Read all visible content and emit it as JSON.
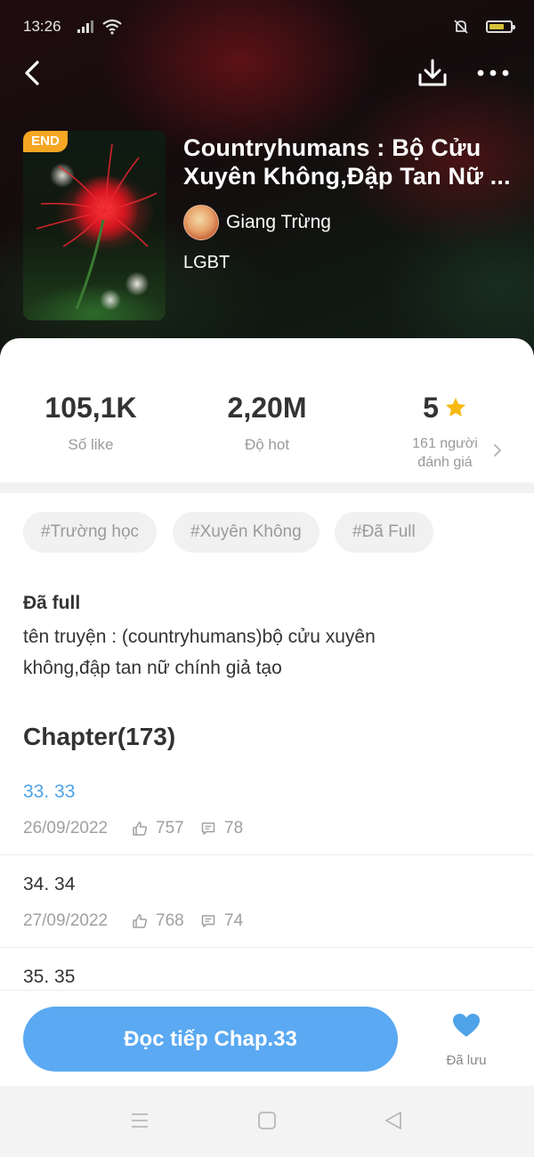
{
  "status_bar": {
    "time": "13:26"
  },
  "header": {
    "end_badge": "END",
    "title_line1": "Countryhumans : Bộ Cửu",
    "title_line2": "Xuyên Không,Đập Tan Nữ ...",
    "author": "Giang Trừng",
    "genre": "LGBT"
  },
  "stats": {
    "likes": {
      "value": "105,1K",
      "label": "Số like"
    },
    "hot": {
      "value": "2,20M",
      "label": "Độ hot"
    },
    "rating": {
      "value": "5",
      "count_line1": "161 người",
      "count_line2": "đánh giá"
    }
  },
  "tags": [
    "#Trường học",
    "#Xuyên Không",
    "#Đã Full"
  ],
  "description": {
    "title": "Đã full",
    "text": "tên truyện : (countryhumans)bộ cửu xuyên không,đập tan nữ chính giả tạo"
  },
  "chapters": {
    "heading": "Chapter(173)",
    "items": [
      {
        "title": "33. 33",
        "date": "26/09/2022",
        "likes": "757",
        "comments": "78",
        "active": true
      },
      {
        "title": "34. 34",
        "date": "27/09/2022",
        "likes": "768",
        "comments": "74",
        "active": false
      },
      {
        "title": "35. 35",
        "date": "",
        "likes": "",
        "comments": "",
        "active": false
      }
    ]
  },
  "actions": {
    "read_label": "Đọc tiếp Chap.33",
    "save_label": "Đã lưu"
  },
  "colors": {
    "accent": "#5aa9f2",
    "active_chapter": "#4fa3e8",
    "end_badge": "#f5a623",
    "star": "#f7b90f"
  },
  "icons": [
    "signal-icon",
    "wifi-icon",
    "mute-icon",
    "battery-icon",
    "back-arrow-icon",
    "download-icon",
    "more-icon",
    "star-icon",
    "chevron-right-icon",
    "thumb-up-icon",
    "comment-icon",
    "heart-icon",
    "nav-menu-icon",
    "nav-home-icon",
    "nav-back-icon"
  ]
}
